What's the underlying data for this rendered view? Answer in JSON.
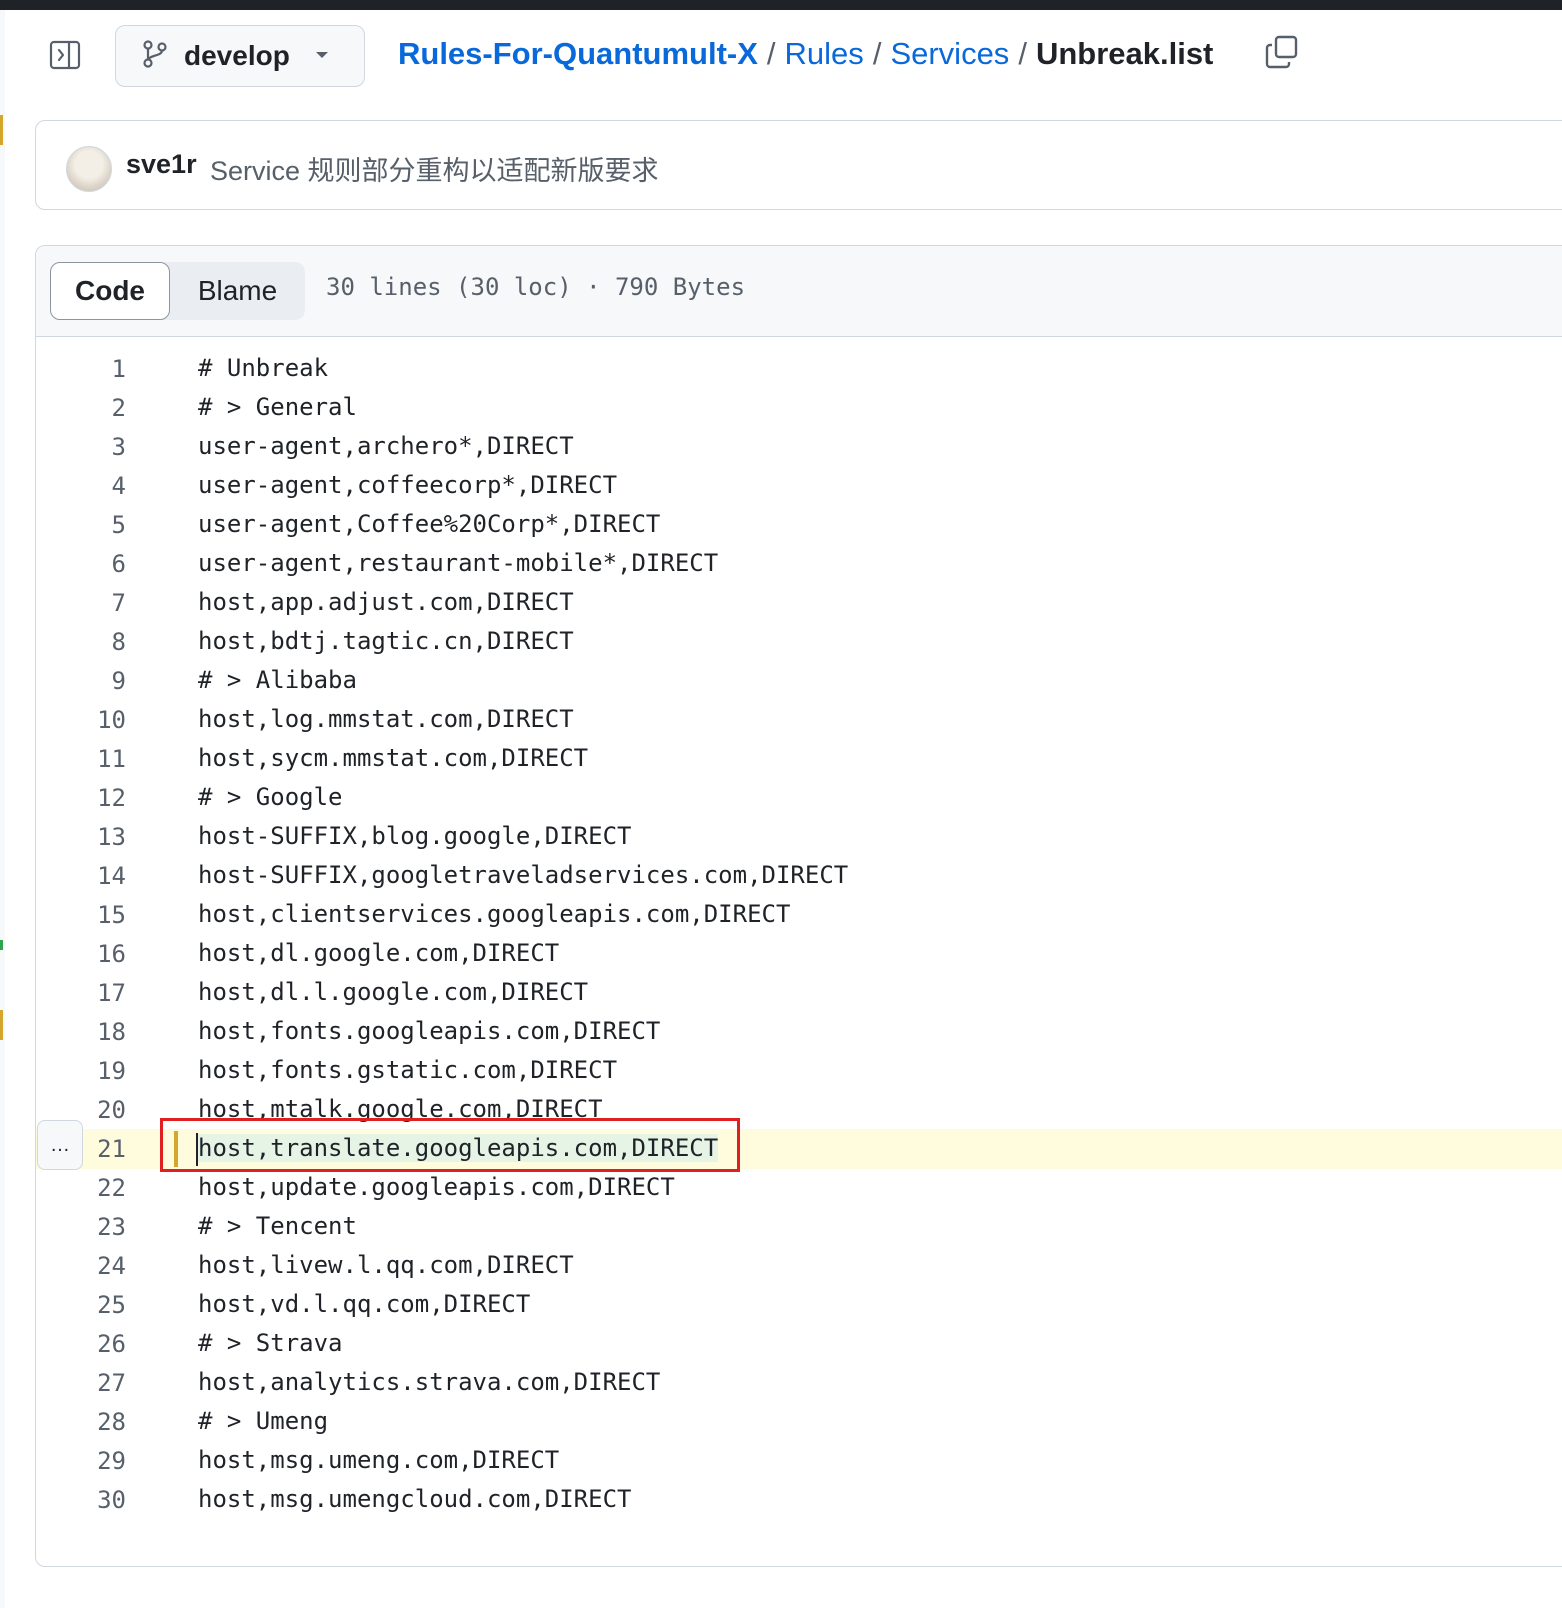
{
  "header": {
    "branch": "develop",
    "breadcrumb": {
      "repo": "Rules-For-Quantumult-X",
      "sep": "/",
      "dir1": "Rules",
      "dir2": "Services",
      "file": "Unbreak.list"
    }
  },
  "commit": {
    "author": "sve1r",
    "message": "Service 规则部分重构以适配新版要求"
  },
  "file": {
    "tabs": {
      "code": "Code",
      "blame": "Blame"
    },
    "stats": "30 lines (30 loc) · 790 Bytes",
    "more_label": "…",
    "highlighted_line": 21,
    "lines": [
      "# Unbreak",
      "# > General",
      "user-agent,archero*,DIRECT",
      "user-agent,coffeecorp*,DIRECT",
      "user-agent,Coffee%20Corp*,DIRECT",
      "user-agent,restaurant-mobile*,DIRECT",
      "host,app.adjust.com,DIRECT",
      "host,bdtj.tagtic.cn,DIRECT",
      "# > Alibaba",
      "host,log.mmstat.com,DIRECT",
      "host,sycm.mmstat.com,DIRECT",
      "# > Google",
      "host-SUFFIX,blog.google,DIRECT",
      "host-SUFFIX,googletraveladservices.com,DIRECT",
      "host,clientservices.googleapis.com,DIRECT",
      "host,dl.google.com,DIRECT",
      "host,dl.l.google.com,DIRECT",
      "host,fonts.googleapis.com,DIRECT",
      "host,fonts.gstatic.com,DIRECT",
      "host,mtalk.google.com,DIRECT",
      "host,translate.googleapis.com,DIRECT",
      "host,update.googleapis.com,DIRECT",
      "# > Tencent",
      "host,livew.l.qq.com,DIRECT",
      "host,vd.l.qq.com,DIRECT",
      "# > Strava",
      "host,analytics.strava.com,DIRECT",
      "# > Umeng",
      "host,msg.umeng.com,DIRECT",
      "host,msg.umengcloud.com,DIRECT"
    ]
  },
  "colors": {
    "link": "#0969da",
    "highlight_bg": "#fffbdd",
    "highlight_bar": "#d4a72c",
    "annotation": "#e02020"
  }
}
